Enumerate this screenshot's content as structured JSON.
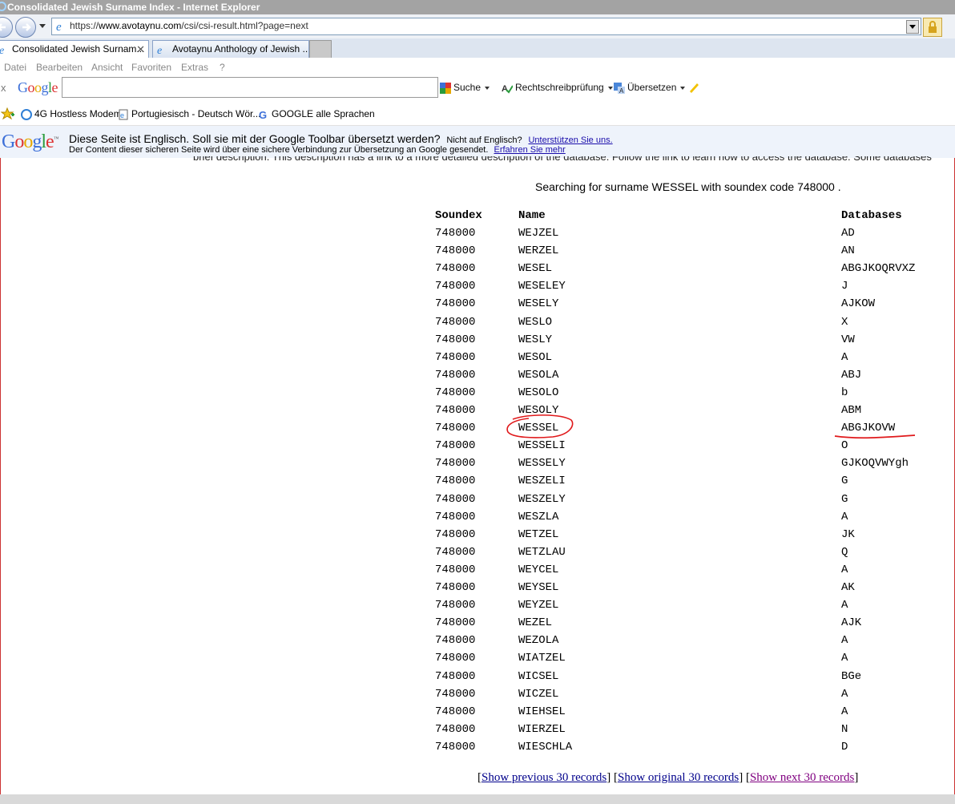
{
  "window": {
    "title": "Consolidated Jewish Surname Index - Internet Explorer"
  },
  "address_bar": {
    "url_prefix": "https://",
    "url_host": "www.avotaynu.com",
    "url_path": "/csi/csi-result.html?page=next"
  },
  "tabs": [
    {
      "label": "Consolidated Jewish Surnam..."
    },
    {
      "label": "Avotaynu Anthology of Jewish ..."
    }
  ],
  "menu": [
    "Datei",
    "Bearbeiten",
    "Ansicht",
    "Favoriten",
    "Extras",
    "?"
  ],
  "google_toolbar": {
    "close": "x",
    "logo": "Google",
    "search_label": "Suche",
    "spell_label": "Rechtschreibprüfung",
    "translate_label": "Übersetzen"
  },
  "favorites": [
    {
      "label": "4G Hostless Modem"
    },
    {
      "label": "Portugiesisch - Deutsch Wör..."
    },
    {
      "label": "GOOGLE alle Sprachen"
    }
  ],
  "translate_bar": {
    "logo": "Google",
    "question": "Diese Seite ist Englisch. Soll sie mit der Google Toolbar übersetzt werden?",
    "not_english": "Nicht auf Englisch?",
    "support_link": "Unterstützen Sie uns.",
    "note": "Der Content dieser sicheren Seite wird über eine sichere Verbindung zur Übersetzung an Google gesendet.",
    "learn_link": "Erfahren Sie mehr"
  },
  "page": {
    "cutoff_text": "brief description. This description has a link to a more detailed description of the database. Follow the link to learn how to access the database. Some databases",
    "searching_text": "Searching for surname WESSEL with soundex code 748000 .",
    "table": {
      "headers": [
        "Soundex",
        "Name",
        "Databases"
      ],
      "rows": [
        {
          "soundex": "748000",
          "name": "WEJZEL",
          "databases": "AD"
        },
        {
          "soundex": "748000",
          "name": "WERZEL",
          "databases": "AN"
        },
        {
          "soundex": "748000",
          "name": "WESEL",
          "databases": "ABGJKOQRVXZ"
        },
        {
          "soundex": "748000",
          "name": "WESELEY",
          "databases": "J"
        },
        {
          "soundex": "748000",
          "name": "WESELY",
          "databases": "AJKOW"
        },
        {
          "soundex": "748000",
          "name": "WESLO",
          "databases": "X"
        },
        {
          "soundex": "748000",
          "name": "WESLY",
          "databases": "VW"
        },
        {
          "soundex": "748000",
          "name": "WESOL",
          "databases": "A"
        },
        {
          "soundex": "748000",
          "name": "WESOLA",
          "databases": "ABJ"
        },
        {
          "soundex": "748000",
          "name": "WESOLO",
          "databases": "b"
        },
        {
          "soundex": "748000",
          "name": "WESOLY",
          "databases": "ABM"
        },
        {
          "soundex": "748000",
          "name": "WESSEL",
          "databases": "ABGJKOVW"
        },
        {
          "soundex": "748000",
          "name": "WESSELI",
          "databases": "O"
        },
        {
          "soundex": "748000",
          "name": "WESSELY",
          "databases": "GJKOQVWYgh"
        },
        {
          "soundex": "748000",
          "name": "WESZELI",
          "databases": "G"
        },
        {
          "soundex": "748000",
          "name": "WESZELY",
          "databases": "G"
        },
        {
          "soundex": "748000",
          "name": "WESZLA",
          "databases": "A"
        },
        {
          "soundex": "748000",
          "name": "WETZEL",
          "databases": "JK"
        },
        {
          "soundex": "748000",
          "name": "WETZLAU",
          "databases": "Q"
        },
        {
          "soundex": "748000",
          "name": "WEYCEL",
          "databases": "A"
        },
        {
          "soundex": "748000",
          "name": "WEYSEL",
          "databases": "AK"
        },
        {
          "soundex": "748000",
          "name": "WEYZEL",
          "databases": "A"
        },
        {
          "soundex": "748000",
          "name": "WEZEL",
          "databases": "AJK"
        },
        {
          "soundex": "748000",
          "name": "WEZOLA",
          "databases": "A"
        },
        {
          "soundex": "748000",
          "name": "WIATZEL",
          "databases": "A"
        },
        {
          "soundex": "748000",
          "name": "WICSEL",
          "databases": "BGe"
        },
        {
          "soundex": "748000",
          "name": "WICZEL",
          "databases": "A"
        },
        {
          "soundex": "748000",
          "name": "WIEHSEL",
          "databases": "A"
        },
        {
          "soundex": "748000",
          "name": "WIERZEL",
          "databases": "N"
        },
        {
          "soundex": "748000",
          "name": "WIESCHLA",
          "databases": "D"
        }
      ]
    },
    "pager": {
      "prev": "Show previous 30 records",
      "original": "Show original 30 records",
      "next": "Show next 30 records"
    }
  },
  "colors": {
    "annotation_red": "#e0191b",
    "link_blue": "#00008b",
    "link_visited": "#800080"
  }
}
